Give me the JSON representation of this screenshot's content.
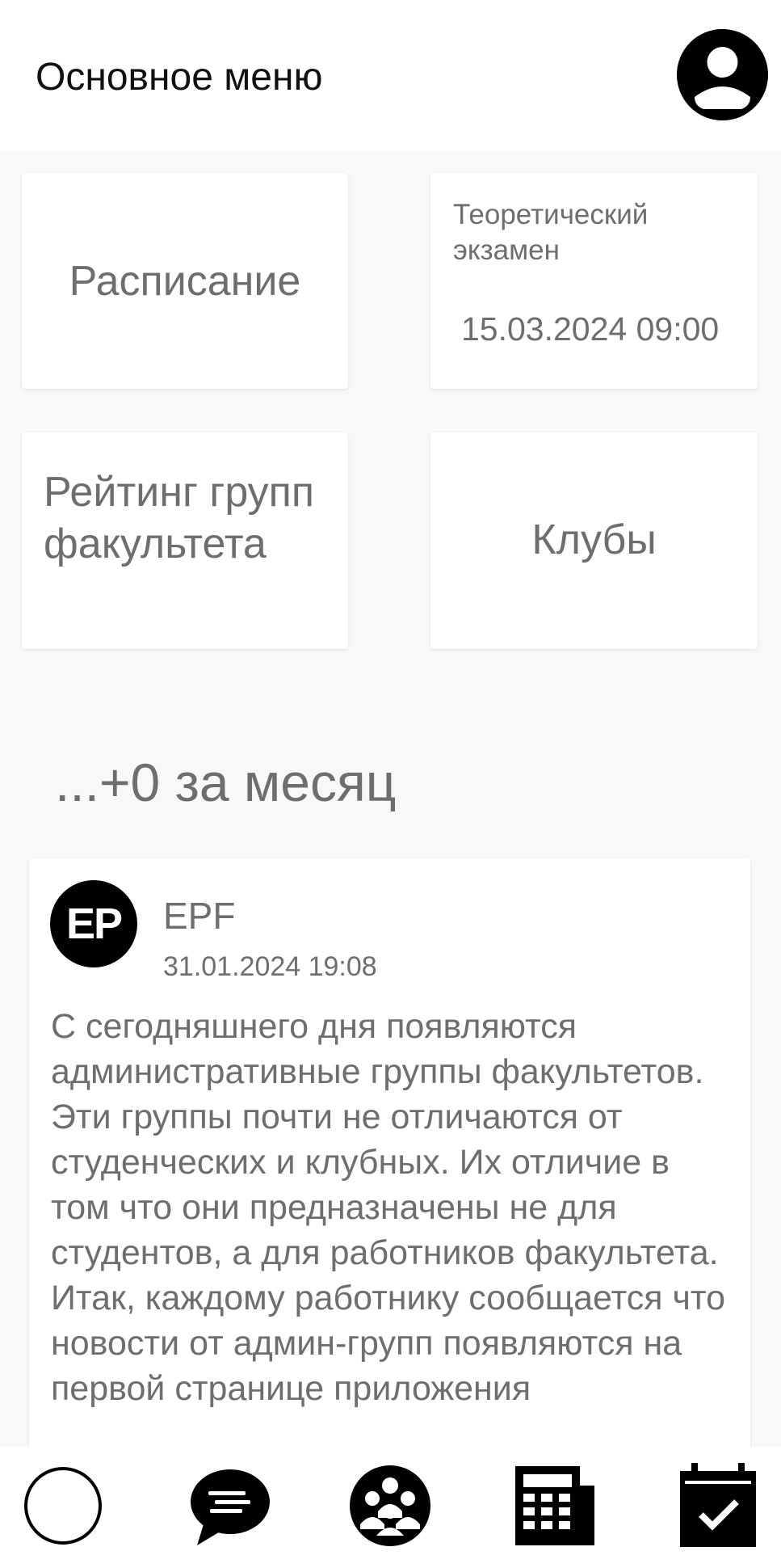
{
  "header": {
    "title": "Основное меню",
    "profile_icon": "account-circle-icon"
  },
  "tiles": {
    "schedule": {
      "label": "Расписание"
    },
    "exam": {
      "title": "Теоретический экзамен",
      "datetime": "15.03.2024 09:00"
    },
    "rating": {
      "label": "Рейтинг групп факультета"
    },
    "clubs": {
      "label": "Клубы"
    }
  },
  "news_summary": "...+0 за месяц",
  "news": [
    {
      "avatar_text": "EP",
      "author": "EPF",
      "date": "31.01.2024 19:08",
      "text": "С сегодняшнего дня появляются административные группы факультетов. Эти группы почти не отличаются от студенческих и клубных. Их отличие в том что они предназначены не для студентов, а для работников факультета. Итак, каждому работнику сообщается что новости от админ-групп появляются на первой странице приложения"
    }
  ],
  "bottom_nav": [
    {
      "icon": "home-circle-icon"
    },
    {
      "icon": "chat-bubble-icon"
    },
    {
      "icon": "groups-icon"
    },
    {
      "icon": "calculator-icon"
    },
    {
      "icon": "calendar-check-icon"
    }
  ]
}
